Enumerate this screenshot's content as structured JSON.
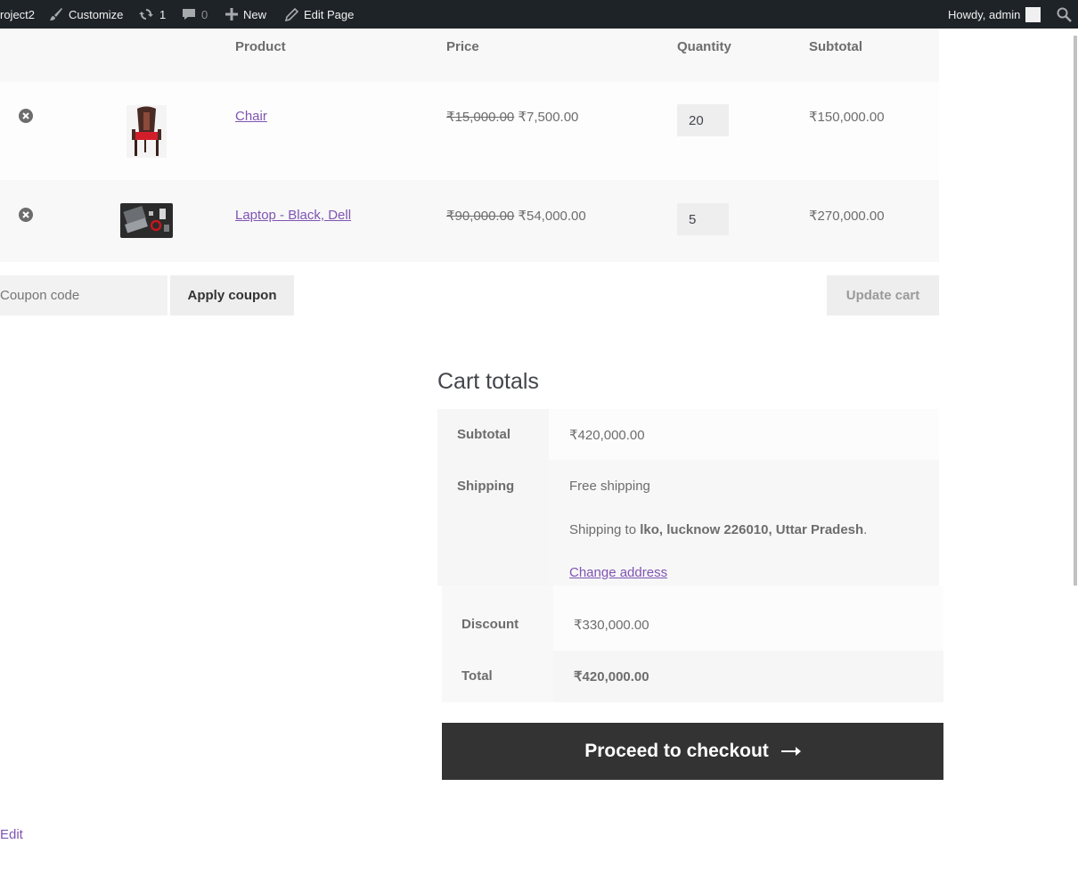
{
  "adminbar": {
    "site_name": "roject2",
    "customize_label": "Customize",
    "updates_count": "1",
    "comments_count": "0",
    "new_label": "New",
    "edit_page_label": "Edit Page",
    "howdy_label": "Howdy, admin",
    "icons": [
      "brush-icon",
      "updates-icon",
      "comment-icon",
      "plus-icon",
      "pencil-icon",
      "search-icon"
    ]
  },
  "cart": {
    "headers": {
      "product": "Product",
      "price": "Price",
      "quantity": "Quantity",
      "subtotal": "Subtotal"
    },
    "items": [
      {
        "name": "Chair",
        "regular_price": "₹15,000.00",
        "sale_price": "₹7,500.00",
        "quantity": "20",
        "subtotal": "₹150,000.00",
        "thumbnail": "red-armchair"
      },
      {
        "name": "Laptop - Black, Dell",
        "regular_price": "₹90,000.00",
        "sale_price": "₹54,000.00",
        "quantity": "5",
        "subtotal": "₹270,000.00",
        "thumbnail": "laptop-desk"
      }
    ],
    "coupon_placeholder": "Coupon code",
    "apply_coupon_label": "Apply coupon",
    "update_cart_label": "Update cart"
  },
  "totals": {
    "title": "Cart totals",
    "subtotal_label": "Subtotal",
    "subtotal_value": "₹420,000.00",
    "shipping_label": "Shipping",
    "shipping_method": "Free shipping",
    "shipping_to_prefix": "Shipping to ",
    "shipping_address": "lko, lucknow 226010, Uttar Pradesh",
    "shipping_to_suffix": ".",
    "change_address_label": "Change address",
    "discount_label": "Discount",
    "discount_value": "₹330,000.00",
    "total_label": "Total",
    "total_value": "₹420,000.00",
    "checkout_label": "Proceed to checkout"
  },
  "footer": {
    "edit_label": "Edit"
  },
  "colors": {
    "adminbar_bg": "#1d2327",
    "link": "#7f54b3",
    "checkout_bg": "#333333"
  }
}
